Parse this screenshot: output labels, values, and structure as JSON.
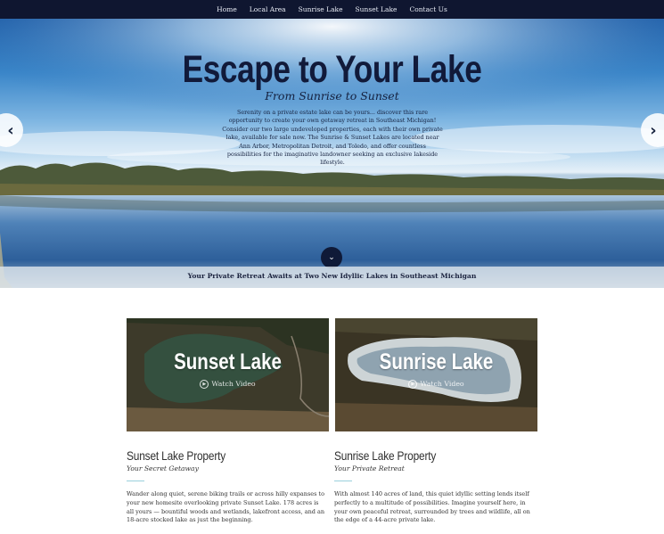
{
  "nav": {
    "items": [
      "Home",
      "Local Area",
      "Sunrise Lake",
      "Sunset Lake",
      "Contact Us"
    ]
  },
  "hero": {
    "title": "Escape to Your Lake",
    "subtitle": "From Sunrise to Sunset",
    "text": "Serenity on a private estate lake can be yours... discover this rare opportunity to create your own getaway retreat in Southeast Michigan! Consider our two large undeveloped properties, each with their own private lake, available for sale now. The Sunrise & Sunset Lakes are located near Ann Arbor, Metropolitan Detroit, and Toledo, and offer countless possibilities for the imaginative landowner seeking an exclusive lakeside lifestyle.",
    "band_text": "Your Private Retreat Awaits at Two New Idyllic Lakes in Southeast Michigan",
    "prev_icon": "‹",
    "next_icon": "›",
    "scroll_icon": "⌄"
  },
  "cards": [
    {
      "label": "Sunset Lake",
      "watch": "Watch Video",
      "title": "Sunset Lake Property",
      "tagline": "Your Secret Getaway",
      "body": "Wander along quiet, serene biking trails or across hilly expanses to your new homesite overlooking private Sunset Lake. 178 acres is all yours — bountiful woods and wetlands, lakefront access, and an 18-acre stocked lake as just the beginning."
    },
    {
      "label": "Sunrise Lake",
      "watch": "Watch Video",
      "title": "Sunrise Lake Property",
      "tagline": "Your Private Retreat",
      "body": "With almost 140 acres of land, this quiet idyllic setting lends itself perfectly to a multitude of possibilities. Imagine yourself here, in your own peaceful retreat, surrounded by trees and wildlife, all on the edge of a 44-acre private lake."
    }
  ],
  "colors": {
    "nav_bg": "#0f1630",
    "title": "#111a3a",
    "accent_rule": "#9ad0dc"
  }
}
